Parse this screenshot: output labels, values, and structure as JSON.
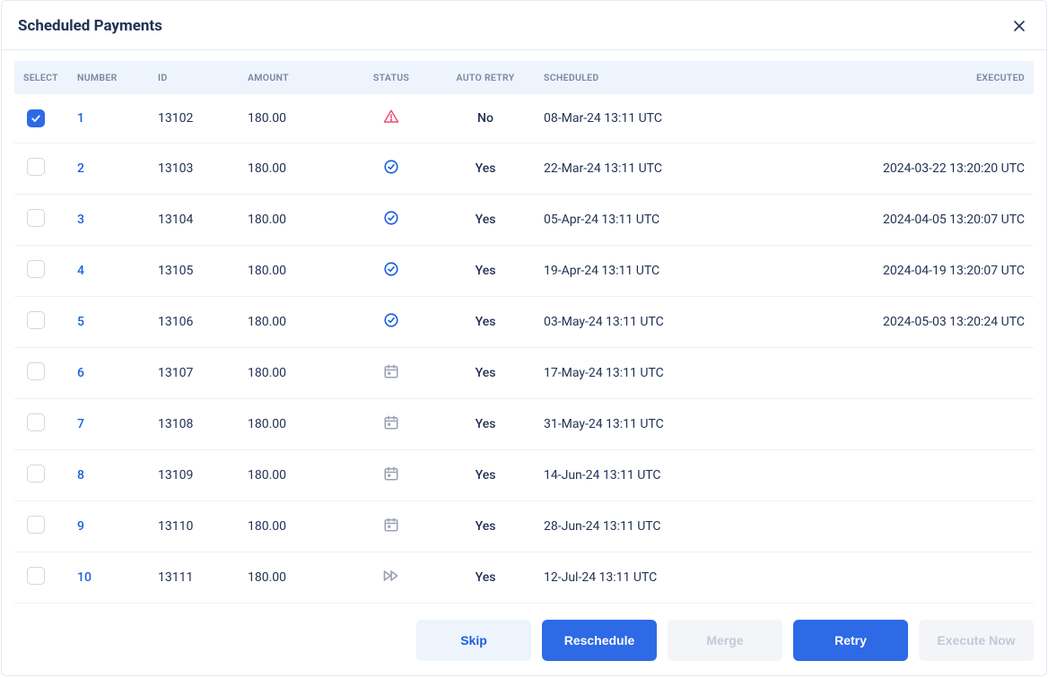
{
  "title": "Scheduled Payments",
  "columns": {
    "select": "SELECT",
    "number": "NUMBER",
    "id": "ID",
    "amount": "AMOUNT",
    "status": "STATUS",
    "auto_retry": "AUTO RETRY",
    "scheduled": "SCHEDULED",
    "executed": "EXECUTED"
  },
  "rows": [
    {
      "selected": true,
      "number": "1",
      "id": "13102",
      "amount": "180.00",
      "status": "warning",
      "auto_retry": "No",
      "scheduled": "08-Mar-24 13:11 UTC",
      "executed": ""
    },
    {
      "selected": false,
      "number": "2",
      "id": "13103",
      "amount": "180.00",
      "status": "done",
      "auto_retry": "Yes",
      "scheduled": "22-Mar-24 13:11 UTC",
      "executed": "2024-03-22 13:20:20 UTC"
    },
    {
      "selected": false,
      "number": "3",
      "id": "13104",
      "amount": "180.00",
      "status": "done",
      "auto_retry": "Yes",
      "scheduled": "05-Apr-24 13:11 UTC",
      "executed": "2024-04-05 13:20:07 UTC"
    },
    {
      "selected": false,
      "number": "4",
      "id": "13105",
      "amount": "180.00",
      "status": "done",
      "auto_retry": "Yes",
      "scheduled": "19-Apr-24 13:11 UTC",
      "executed": "2024-04-19 13:20:07 UTC"
    },
    {
      "selected": false,
      "number": "5",
      "id": "13106",
      "amount": "180.00",
      "status": "done",
      "auto_retry": "Yes",
      "scheduled": "03-May-24 13:11 UTC",
      "executed": "2024-05-03 13:20:24 UTC"
    },
    {
      "selected": false,
      "number": "6",
      "id": "13107",
      "amount": "180.00",
      "status": "scheduled",
      "auto_retry": "Yes",
      "scheduled": "17-May-24 13:11 UTC",
      "executed": ""
    },
    {
      "selected": false,
      "number": "7",
      "id": "13108",
      "amount": "180.00",
      "status": "scheduled",
      "auto_retry": "Yes",
      "scheduled": "31-May-24 13:11 UTC",
      "executed": ""
    },
    {
      "selected": false,
      "number": "8",
      "id": "13109",
      "amount": "180.00",
      "status": "scheduled",
      "auto_retry": "Yes",
      "scheduled": "14-Jun-24 13:11 UTC",
      "executed": ""
    },
    {
      "selected": false,
      "number": "9",
      "id": "13110",
      "amount": "180.00",
      "status": "scheduled",
      "auto_retry": "Yes",
      "scheduled": "28-Jun-24 13:11 UTC",
      "executed": ""
    },
    {
      "selected": false,
      "number": "10",
      "id": "13111",
      "amount": "180.00",
      "status": "skip",
      "auto_retry": "Yes",
      "scheduled": "12-Jul-24 13:11 UTC",
      "executed": ""
    }
  ],
  "buttons": {
    "skip": "Skip",
    "reschedule": "Reschedule",
    "merge": "Merge",
    "retry": "Retry",
    "execute": "Execute Now"
  }
}
